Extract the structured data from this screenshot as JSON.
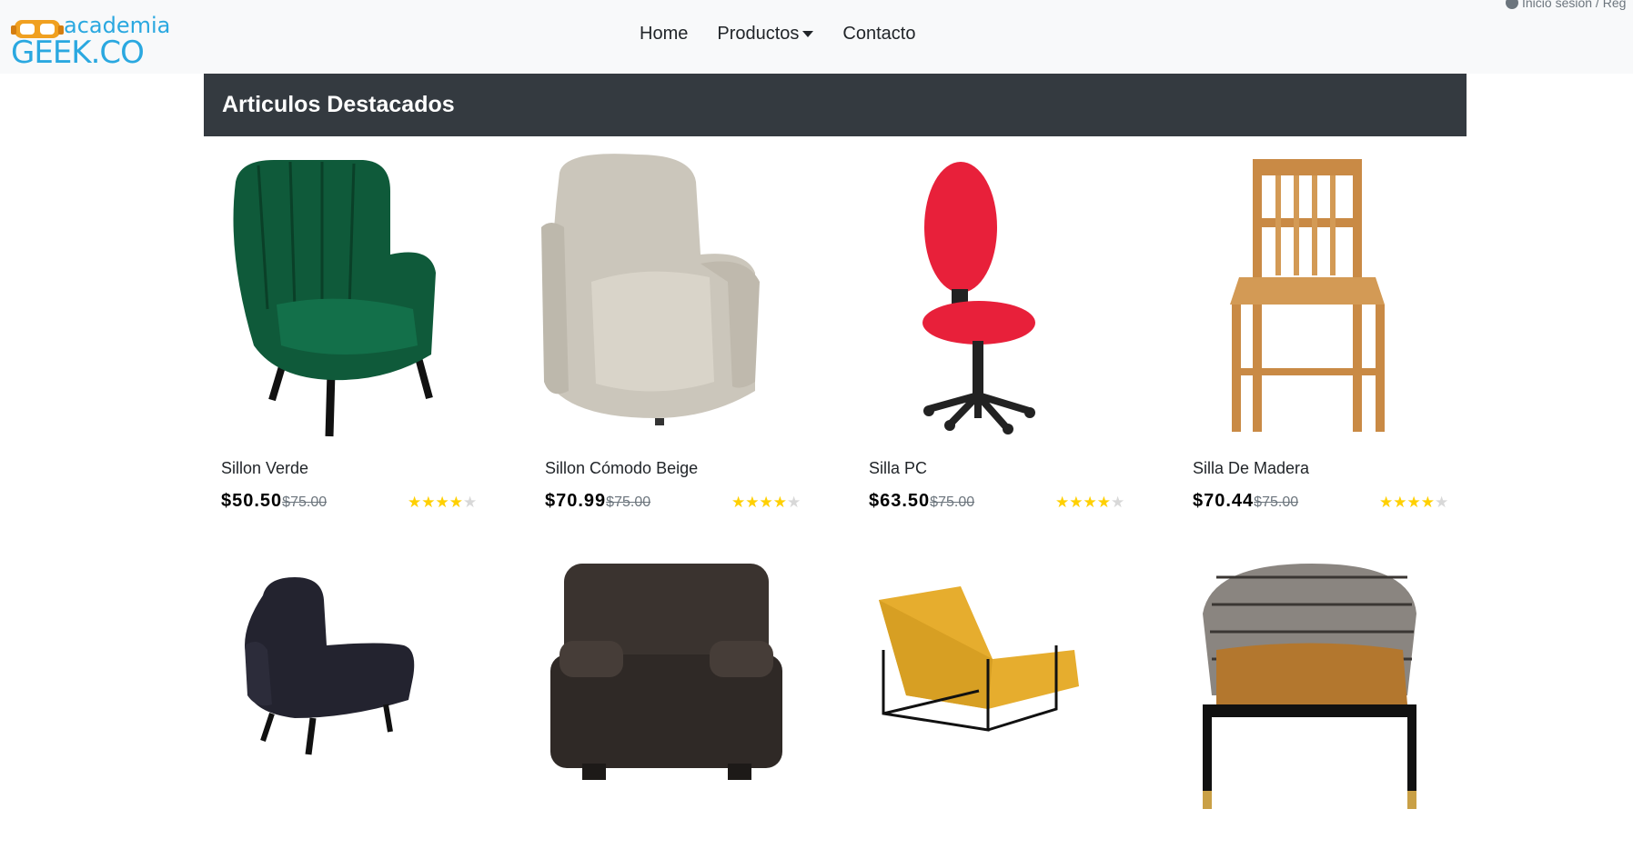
{
  "brand": {
    "top": "academia",
    "bottom": "GEEK.CO"
  },
  "nav": {
    "items": [
      {
        "label": "Home"
      },
      {
        "label": "Productos"
      },
      {
        "label": "Contacto"
      }
    ],
    "login": "Inicio sesión / Reg"
  },
  "section": {
    "title": "Articulos Destacados"
  },
  "colors": {
    "header_bg": "#343a40",
    "star": "#ffd000",
    "brand": "#2aa8e0"
  },
  "products": [
    {
      "name": "Sillon Verde",
      "price": "$50.50",
      "old_price": "$75.00",
      "rating": 4,
      "image": "green-velvet-armchair"
    },
    {
      "name": "Sillon Cómodo Beige",
      "price": "$70.99",
      "old_price": "$75.00",
      "rating": 4,
      "image": "beige-recliner"
    },
    {
      "name": "Silla PC",
      "price": "$63.50",
      "old_price": "$75.00",
      "rating": 4,
      "image": "red-office-chair"
    },
    {
      "name": "Silla De Madera",
      "price": "$70.44",
      "old_price": "$75.00",
      "rating": 4,
      "image": "wooden-chair"
    },
    {
      "name": "",
      "price": "",
      "old_price": "",
      "rating": 0,
      "image": "navy-armchair"
    },
    {
      "name": "",
      "price": "",
      "old_price": "",
      "rating": 0,
      "image": "brown-leather-armchair"
    },
    {
      "name": "",
      "price": "",
      "old_price": "",
      "rating": 0,
      "image": "mustard-lounge-chair"
    },
    {
      "name": "",
      "price": "",
      "old_price": "",
      "rating": 0,
      "image": "houndstooth-armchair"
    }
  ]
}
